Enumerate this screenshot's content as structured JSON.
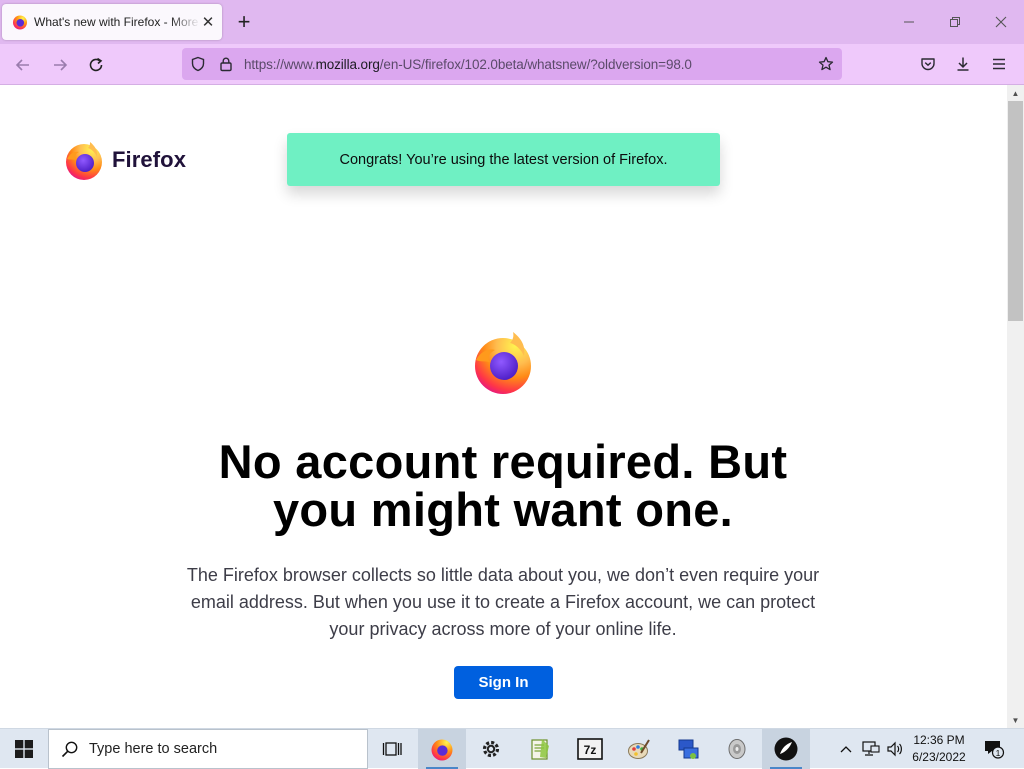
{
  "browser": {
    "tab": {
      "title": "What's new with Firefox - More"
    },
    "url": {
      "prefix": "https://www.",
      "domain": "mozilla.org",
      "path": "/en-US/firefox/102.0beta/whatsnew/?oldversion=98.0"
    }
  },
  "page": {
    "brand": "Firefox",
    "notice": "Congrats! You’re using the latest version of Firefox.",
    "headline_line1": "No account required. But",
    "headline_line2": "you might want one.",
    "body_line1": "The Firefox browser collects so little data about you, we don’t even require your",
    "body_line2": "email address. But when you use it to create a Firefox account, we can protect",
    "body_line3": "your privacy across more of your online life.",
    "signin_label": "Sign In"
  },
  "taskbar": {
    "search_placeholder": "Type here to search",
    "time": "12:36 PM",
    "date": "6/23/2022",
    "notification_count": "1",
    "pinned_apps": [
      "task-view",
      "firefox",
      "settings",
      "notepad-plus",
      "7zip",
      "paint",
      "network-app",
      "disk-app",
      "inkscape"
    ]
  },
  "colors": {
    "tabstrip": "#e0b8f0",
    "navbar": "#efc9fb",
    "urlbar": "#dba7ef",
    "notice_bg": "#6ff0c3",
    "signin_bg": "#0060df"
  }
}
